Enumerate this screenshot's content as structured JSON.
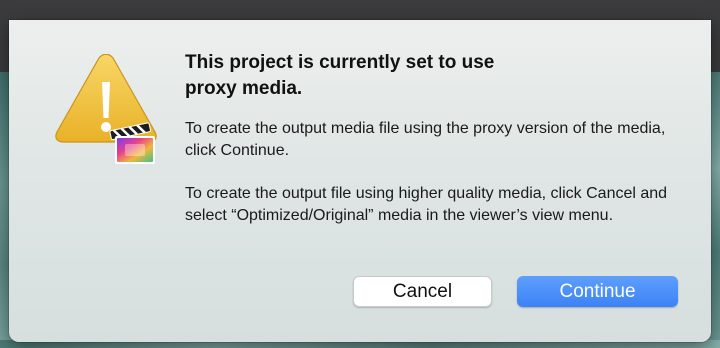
{
  "dialog": {
    "title": "This project is currently set to use\nproxy media.",
    "paragraph_1": "To create the output media file using the proxy version of the media, click Continue.",
    "paragraph_2": "To create the output file using higher quality media, click Cancel and select “Optimized/Original” media in the viewer’s view menu.",
    "cancel_label": "Cancel",
    "continue_label": "Continue"
  },
  "icons": {
    "warning": "warning-triangle-icon",
    "app": "final-cut-pro-clapper-icon"
  },
  "colors": {
    "accent": "#3c82f7",
    "warning_yellow": "#f0c243"
  }
}
